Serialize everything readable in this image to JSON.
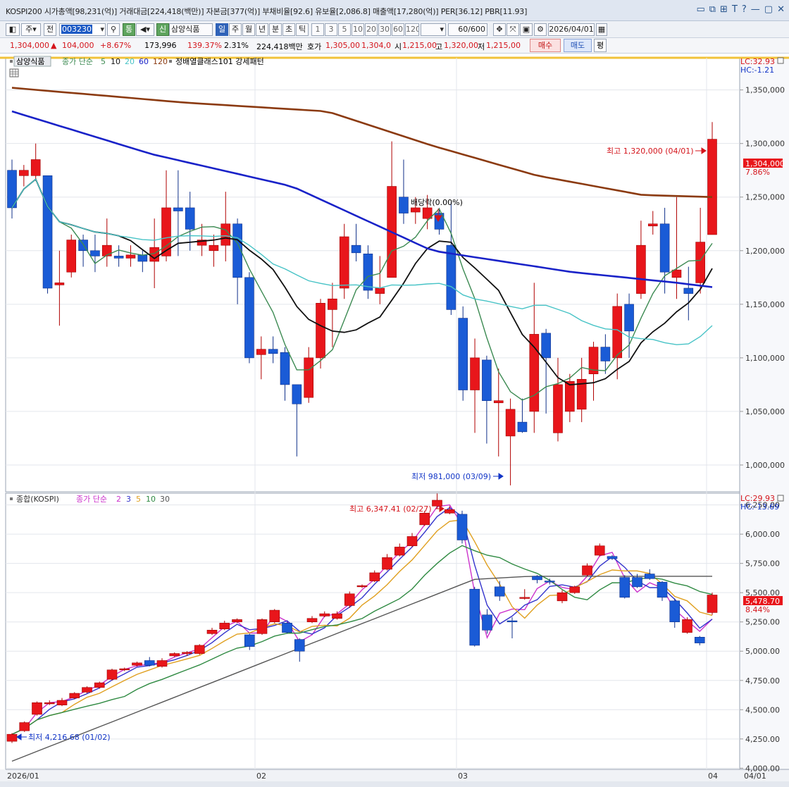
{
  "title_bar": {
    "text": "KOSPI200 시가총액[98,231(억)] 거래대금[224,418(백만)] 자본금[377(억)] 부채비율[92.6] 유보율[2,086.8] 매출액[17,280(억)] PER[36.12] PBR[11.93]",
    "controls": [
      "▭",
      "⧉",
      "⊞",
      "T",
      "?",
      "—",
      "▢",
      "✕"
    ]
  },
  "toolbar": {
    "type_select": "주",
    "prev_label": "전",
    "stock_code": "003230",
    "stock_name": "삼양식품",
    "new_badge": "신",
    "tong_label": "통",
    "periods": [
      "일",
      "주",
      "월",
      "년",
      "분",
      "초",
      "틱"
    ],
    "active_period": "일",
    "minute_steps": [
      "1",
      "3",
      "5",
      "10",
      "20",
      "30",
      "60",
      "120"
    ],
    "count": "60/600",
    "date": "2026/04/01"
  },
  "quote": {
    "price": "1,304,000",
    "change_arrow": "▲",
    "change": "104,000",
    "change_pct": "+8.67%",
    "volume": "173,996",
    "volume_ratio": "139.37%",
    "turnover": "2.31%",
    "amount": "224,418백만",
    "ask_label": "호가",
    "ask1": "1,305,00",
    "ask2": "1,304,0",
    "open_label": "시",
    "open": "1,215,00",
    "high_label": "고",
    "high": "1,320,00",
    "low_label": "저",
    "low": "1,215,00",
    "buy": "매수",
    "sell": "매도",
    "eval": "평"
  },
  "upper_panel": {
    "name": "삼양식품",
    "ma_prefix": "종가 단순",
    "ma_periods": [
      "5",
      "10",
      "20",
      "60",
      "120"
    ],
    "pattern_label": "정배열클래스101 강세패턴",
    "lc": "LC:32.93",
    "hc": "HC:-1.21",
    "max_label": "최고 1,320,000 (04/01)",
    "min_label": "최저 981,000 (03/09)",
    "dividend_label": "배당락(0.00%)",
    "price_tag": "1,304,000",
    "pct_tag": "7.86%",
    "yticks": [
      "1,350,000",
      "1,300,000",
      "1,250,000",
      "1,200,000",
      "1,150,000",
      "1,100,000",
      "1,050,000",
      "1,000,000"
    ]
  },
  "lower_panel": {
    "name": "종합(KOSPI)",
    "ma_prefix": "종가 단순",
    "ma_periods": [
      "2",
      "3",
      "5",
      "10",
      "30"
    ],
    "lc": "LC:29.93",
    "hc": "HC:-13.69",
    "max_label": "최고 6,347.41 (02/27)",
    "min_label": "최저 4,216.68 (01/02)",
    "price_tag": "5,478.70",
    "pct_tag": "8.44%",
    "yticks": [
      "6,250.00",
      "6,000.00",
      "5,750.00",
      "5,500.00",
      "5,250.00",
      "5,000.00",
      "4,750.00",
      "4,500.00",
      "4,250.00",
      "4,000.00"
    ]
  },
  "xaxis": {
    "labels": [
      "2026/01",
      "02",
      "03",
      "04"
    ],
    "right_label": "04/01"
  },
  "chart_data": [
    {
      "type": "candlestick",
      "name": "삼양식품",
      "ylim": [
        975000,
        1380000
      ],
      "colors": {
        "up": "#e8161b",
        "down": "#1a5bd6"
      },
      "candles": [
        [
          1275000,
          1240000,
          1285000,
          1230000
        ],
        [
          1270000,
          1275000,
          1280000,
          1260000
        ],
        [
          1270000,
          1285000,
          1300000,
          1265000
        ],
        [
          1270000,
          1165000,
          1270000,
          1160000
        ],
        [
          1168000,
          1170000,
          1200000,
          1130000
        ],
        [
          1180000,
          1210000,
          1215000,
          1175000
        ],
        [
          1210000,
          1200000,
          1215000,
          1185000
        ],
        [
          1200000,
          1195000,
          1215000,
          1180000
        ],
        [
          1195000,
          1205000,
          1230000,
          1185000
        ],
        [
          1195000,
          1193000,
          1205000,
          1185000
        ],
        [
          1193000,
          1196000,
          1205000,
          1185000
        ],
        [
          1196000,
          1190000,
          1200000,
          1180000
        ],
        [
          1190000,
          1203000,
          1230000,
          1165000
        ],
        [
          1195000,
          1240000,
          1275000,
          1190000
        ],
        [
          1240000,
          1237000,
          1275000,
          1195000
        ],
        [
          1240000,
          1220000,
          1255000,
          1200000
        ],
        [
          1205000,
          1210000,
          1225000,
          1195000
        ],
        [
          1200000,
          1205000,
          1215000,
          1185000
        ],
        [
          1205000,
          1225000,
          1255000,
          1190000
        ],
        [
          1225000,
          1175000,
          1230000,
          1150000
        ],
        [
          1175000,
          1100000,
          1180000,
          1095000
        ],
        [
          1103000,
          1108000,
          1120000,
          1080000
        ],
        [
          1108000,
          1104000,
          1120000,
          1095000
        ],
        [
          1105000,
          1075000,
          1110000,
          1060000
        ],
        [
          1075000,
          1057000,
          1075000,
          1008000
        ],
        [
          1063000,
          1100000,
          1110000,
          1058000
        ],
        [
          1100000,
          1151000,
          1155000,
          1090000
        ],
        [
          1145000,
          1155000,
          1170000,
          1110000
        ],
        [
          1165000,
          1213000,
          1225000,
          1155000
        ],
        [
          1205000,
          1198000,
          1225000,
          1190000
        ],
        [
          1197000,
          1163000,
          1205000,
          1155000
        ],
        [
          1160000,
          1165000,
          1195000,
          1150000
        ],
        [
          1175000,
          1260000,
          1302000,
          1175000
        ],
        [
          1250000,
          1235000,
          1285000,
          1225000
        ],
        [
          1236000,
          1240000,
          1250000,
          1225000
        ],
        [
          1230000,
          1240000,
          1252000,
          1220000
        ],
        [
          1235000,
          1220000,
          1240000,
          1215000
        ],
        [
          1205000,
          1145000,
          1245000,
          1140000
        ],
        [
          1137000,
          1070000,
          1148000,
          1060000
        ],
        [
          1070000,
          1100000,
          1118000,
          1030000
        ],
        [
          1098000,
          1060000,
          1102000,
          1020000
        ],
        [
          1058000,
          1060000,
          1090000,
          1008000
        ],
        [
          1027000,
          1052000,
          1062000,
          981000
        ],
        [
          1040000,
          1031000,
          1062000,
          1030000
        ],
        [
          1050000,
          1122000,
          1170000,
          1030000
        ],
        [
          1123000,
          1100000,
          1127000,
          1048000
        ],
        [
          1030000,
          1075000,
          1100000,
          1022000
        ],
        [
          1050000,
          1078000,
          1085000,
          1040000
        ],
        [
          1052000,
          1080000,
          1100000,
          1040000
        ],
        [
          1085000,
          1110000,
          1115000,
          1060000
        ],
        [
          1110000,
          1097000,
          1122000,
          1085000
        ],
        [
          1100000,
          1148000,
          1160000,
          1080000
        ],
        [
          1150000,
          1125000,
          1160000,
          1100000
        ],
        [
          1160000,
          1205000,
          1228000,
          1155000
        ],
        [
          1223000,
          1225000,
          1237000,
          1215000
        ],
        [
          1225000,
          1180000,
          1240000,
          1160000
        ],
        [
          1175000,
          1182000,
          1250000,
          1155000
        ],
        [
          1165000,
          1160000,
          1185000,
          1135000
        ],
        [
          1170000,
          1208000,
          1240000,
          1160000
        ],
        [
          1215000,
          1304000,
          1320000,
          1215000
        ]
      ],
      "ma_series": [
        {
          "name": "5",
          "color": "#3c8a52"
        },
        {
          "name": "10",
          "color": "#111111"
        },
        {
          "name": "20",
          "color": "#47c3c6"
        },
        {
          "name": "60",
          "color": "#1922c8"
        },
        {
          "name": "120",
          "color": "#8b3a10"
        }
      ],
      "ma60": [
        [
          0,
          1330000
        ],
        [
          20,
          1290000
        ],
        [
          40,
          1260000
        ],
        [
          60,
          1200000
        ],
        [
          80,
          1180000
        ],
        [
          95,
          1170000
        ],
        [
          100,
          1166000
        ]
      ],
      "ma120": [
        [
          0,
          1352000
        ],
        [
          25,
          1338000
        ],
        [
          45,
          1330000
        ],
        [
          60,
          1298000
        ],
        [
          75,
          1270000
        ],
        [
          90,
          1252000
        ],
        [
          100,
          1250000
        ]
      ]
    },
    {
      "type": "candlestick",
      "name": "종합(KOSPI)",
      "ylim": [
        3990,
        6350
      ],
      "candles": [
        [
          4230,
          4290,
          4300,
          4216
        ],
        [
          4320,
          4390,
          4400,
          4310
        ],
        [
          4460,
          4560,
          4570,
          4450
        ],
        [
          4550,
          4560,
          4580,
          4540
        ],
        [
          4540,
          4580,
          4600,
          4530
        ],
        [
          4600,
          4640,
          4650,
          4590
        ],
        [
          4650,
          4690,
          4700,
          4640
        ],
        [
          4690,
          4730,
          4740,
          4680
        ],
        [
          4760,
          4840,
          4850,
          4750
        ],
        [
          4840,
          4850,
          4860,
          4830
        ],
        [
          4880,
          4900,
          4910,
          4870
        ],
        [
          4920,
          4880,
          4950,
          4870
        ],
        [
          4870,
          4920,
          4940,
          4860
        ],
        [
          4960,
          4980,
          4990,
          4950
        ],
        [
          4980,
          4990,
          5000,
          4960
        ],
        [
          4980,
          5050,
          5060,
          4970
        ],
        [
          5150,
          5180,
          5200,
          5140
        ],
        [
          5190,
          5240,
          5260,
          5180
        ],
        [
          5250,
          5270,
          5280,
          5240
        ],
        [
          5140,
          5040,
          5150,
          5010
        ],
        [
          5150,
          5270,
          5280,
          5140
        ],
        [
          5250,
          5350,
          5360,
          5240
        ],
        [
          5240,
          5160,
          5250,
          5150
        ],
        [
          5100,
          5000,
          5110,
          4910
        ],
        [
          5250,
          5280,
          5300,
          5240
        ],
        [
          5300,
          5320,
          5340,
          5290
        ],
        [
          5280,
          5320,
          5340,
          5270
        ],
        [
          5390,
          5490,
          5510,
          5370
        ],
        [
          5550,
          5560,
          5570,
          5540
        ],
        [
          5600,
          5670,
          5690,
          5590
        ],
        [
          5700,
          5800,
          5830,
          5690
        ],
        [
          5820,
          5890,
          5920,
          5810
        ],
        [
          5900,
          5980,
          6010,
          5890
        ],
        [
          6080,
          6180,
          6200,
          6070
        ],
        [
          6240,
          6290,
          6347,
          6220
        ],
        [
          6180,
          6210,
          6240,
          6170
        ],
        [
          6170,
          5950,
          6200,
          5920
        ],
        [
          5530,
          5050,
          5550,
          5040
        ],
        [
          5310,
          5180,
          5360,
          5150
        ],
        [
          5550,
          5470,
          5600,
          5430
        ],
        [
          5260,
          5250,
          5290,
          5110
        ],
        [
          5450,
          5460,
          5530,
          5440
        ],
        [
          5640,
          5610,
          5650,
          5580
        ],
        [
          5600,
          5590,
          5620,
          5570
        ],
        [
          5430,
          5500,
          5520,
          5410
        ],
        [
          5500,
          5550,
          5560,
          5490
        ],
        [
          5650,
          5730,
          5750,
          5640
        ],
        [
          5820,
          5900,
          5920,
          5810
        ],
        [
          5810,
          5790,
          5820,
          5780
        ],
        [
          5630,
          5460,
          5650,
          5450
        ],
        [
          5630,
          5550,
          5660,
          5540
        ],
        [
          5660,
          5620,
          5700,
          5610
        ],
        [
          5590,
          5460,
          5600,
          5430
        ],
        [
          5430,
          5250,
          5450,
          5200
        ],
        [
          5160,
          5270,
          5290,
          5150
        ],
        [
          5120,
          5070,
          5130,
          5050
        ],
        [
          5330,
          5480,
          5500,
          5310
        ]
      ],
      "ma_series": [
        {
          "name": "2",
          "color": "#cc33cc"
        },
        {
          "name": "3",
          "color": "#3333cc"
        },
        {
          "name": "5",
          "color": "#e0a020"
        },
        {
          "name": "10",
          "color": "#2f8a42"
        },
        {
          "name": "30",
          "color": "#555555"
        }
      ]
    }
  ]
}
